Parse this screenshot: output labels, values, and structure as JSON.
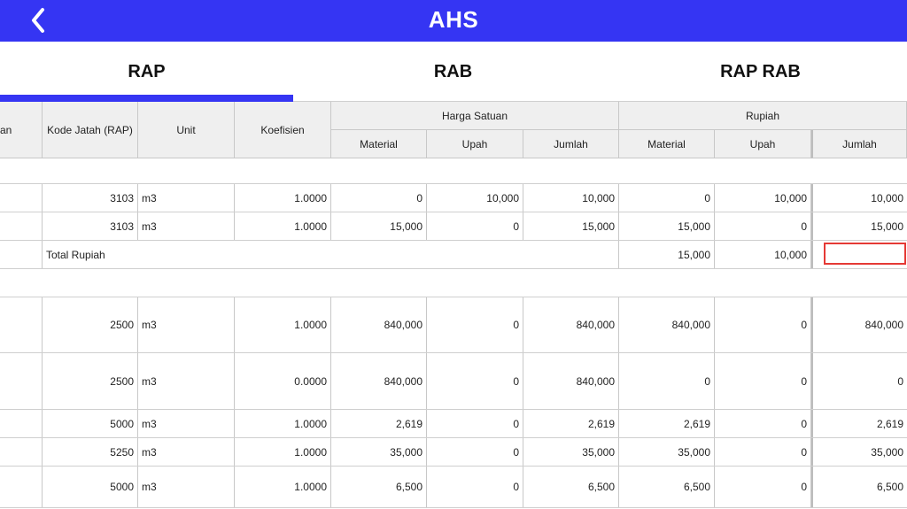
{
  "app": {
    "title": "AHS"
  },
  "tabs": [
    {
      "label": "RAP",
      "active": true
    },
    {
      "label": "RAB",
      "active": false
    },
    {
      "label": "RAP RAB",
      "active": false
    }
  ],
  "table": {
    "headers": {
      "first_partial": "an",
      "kode": "Kode Jatah (RAP)",
      "unit": "Unit",
      "koefisien": "Koefisien",
      "harga_satuan": "Harga Satuan",
      "rupiah": "Rupiah",
      "material": "Material",
      "upah": "Upah",
      "jumlah": "Jumlah",
      "material2": "Material",
      "upah2": "Upah",
      "jumlah2": "Jumlah"
    },
    "rows": [
      {
        "kode": "3103",
        "unit": "m3",
        "koef": "1.0000",
        "hs_mat": "0",
        "hs_upah": "10,000",
        "hs_jml": "10,000",
        "rp_mat": "0",
        "rp_upah": "10,000",
        "rp_jml": "10,000"
      },
      {
        "kode": "3103",
        "unit": "m3",
        "koef": "1.0000",
        "hs_mat": "15,000",
        "hs_upah": "0",
        "hs_jml": "15,000",
        "rp_mat": "15,000",
        "rp_upah": "0",
        "rp_jml": "15,000"
      },
      {
        "kode": "2500",
        "unit": "m3",
        "koef": "1.0000",
        "hs_mat": "840,000",
        "hs_upah": "0",
        "hs_jml": "840,000",
        "rp_mat": "840,000",
        "rp_upah": "0",
        "rp_jml": "840,000"
      },
      {
        "kode": "2500",
        "unit": "m3",
        "koef": "0.0000",
        "hs_mat": "840,000",
        "hs_upah": "0",
        "hs_jml": "840,000",
        "rp_mat": "0",
        "rp_upah": "0",
        "rp_jml": "0"
      },
      {
        "kode": "5000",
        "unit": "m3",
        "koef": "1.0000",
        "hs_mat": "2,619",
        "hs_upah": "0",
        "hs_jml": "2,619",
        "rp_mat": "2,619",
        "rp_upah": "0",
        "rp_jml": "2,619"
      },
      {
        "kode": "5250",
        "unit": "m3",
        "koef": "1.0000",
        "hs_mat": "35,000",
        "hs_upah": "0",
        "hs_jml": "35,000",
        "rp_mat": "35,000",
        "rp_upah": "0",
        "rp_jml": "35,000"
      },
      {
        "kode": "5000",
        "unit": "m3",
        "koef": "1.0000",
        "hs_mat": "6,500",
        "hs_upah": "0",
        "hs_jml": "6,500",
        "rp_mat": "6,500",
        "rp_upah": "0",
        "rp_jml": "6,500"
      }
    ],
    "total": {
      "label": "Total Rupiah",
      "material": "15,000",
      "upah": "10,000",
      "jumlah": ""
    }
  }
}
